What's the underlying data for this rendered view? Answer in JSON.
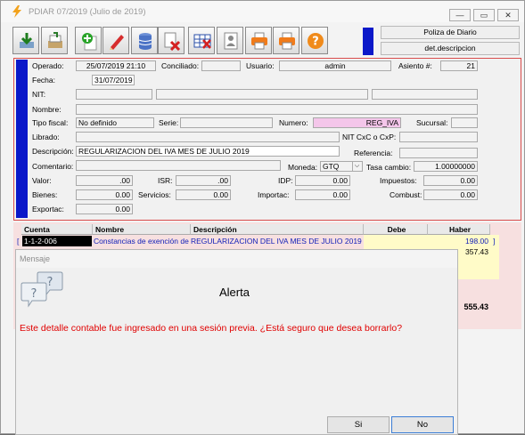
{
  "window": {
    "title": "PDIAR 07/2019 (Julio de 2019)",
    "minimize": "—",
    "restore": "▭",
    "close": "✕"
  },
  "toolbar": {
    "buttons": [
      "save",
      "print-stack",
      "add",
      "edit",
      "delete-db",
      "delete-doc",
      "grid-delete",
      "document",
      "print",
      "print-alt",
      "help"
    ]
  },
  "header": {
    "poliza_tipo": "Poliza de Diario",
    "poliza_desc": "det.descripcion"
  },
  "form": {
    "operado_label": "Operado:",
    "operado_value": "25/07/2019 21:10",
    "conciliado_label": "Conciliado:",
    "conciliado_value": "",
    "usuario_label": "Usuario:",
    "usuario_value": "admin",
    "asiento_label": "Asiento #:",
    "asiento_value": "21",
    "fecha_label": "Fecha:",
    "fecha_value": "31/07/2019",
    "nit_label": "NIT:",
    "nombre_label": "Nombre:",
    "tipo_fiscal_label": "Tipo fiscal:",
    "tipo_fiscal_value": "No definido",
    "serie_label": "Serie:",
    "serie_value": "",
    "numero_label": "Numero:",
    "numero_value": "REG_IVA",
    "sucursal_label": "Sucursal:",
    "sucursal_value": "",
    "librado_label": "Librado:",
    "nit_cxc_label": "NIT CxC o CxP:",
    "descripcion_label": "Descripción:",
    "descripcion_value": "REGULARIZACION DEL IVA MES DE JULIO 2019",
    "referencia_label": "Referencia:",
    "comentario_label": "Comentario:",
    "moneda_label": "Moneda:",
    "moneda_value": "GTQ",
    "tasa_label": "Tasa cambio:",
    "tasa_value": "1.00000000",
    "valor_label": "Valor:",
    "valor_value": ".00",
    "isr_label": "ISR:",
    "isr_value": ".00",
    "idp_label": "IDP:",
    "idp_value": "0.00",
    "impuestos_label": "Impuestos:",
    "impuestos_value": "0.00",
    "bienes_label": "Bienes:",
    "bienes_value": "0.00",
    "servicios_label": "Servicios:",
    "servicios_value": "0.00",
    "importac_label": "Importac:",
    "importac_value": "0.00",
    "combust_label": "Combust:",
    "combust_value": "0.00",
    "exportac_label": "Exportac:",
    "exportac_value": "0.00"
  },
  "grid": {
    "columns": [
      "Cuenta",
      "Nombre",
      "Descripción",
      "Debe",
      "Haber"
    ],
    "row1": {
      "cuenta": "1-1-2-006",
      "nombre": "Constancias de exención de",
      "descripcion": "REGULARIZACION DEL IVA MES DE JULIO 2019",
      "debe": "",
      "haber": "198.00"
    },
    "row2_haber": "357.43",
    "total_haber": "555.43"
  },
  "dialog": {
    "title": "Mensaje",
    "heading": "Alerta",
    "message": "Este detalle contable fue ingresado en una sesión previa.  ¿Está seguro que desea borrarlo?",
    "yes_label": "Si",
    "no_label": "No"
  }
}
